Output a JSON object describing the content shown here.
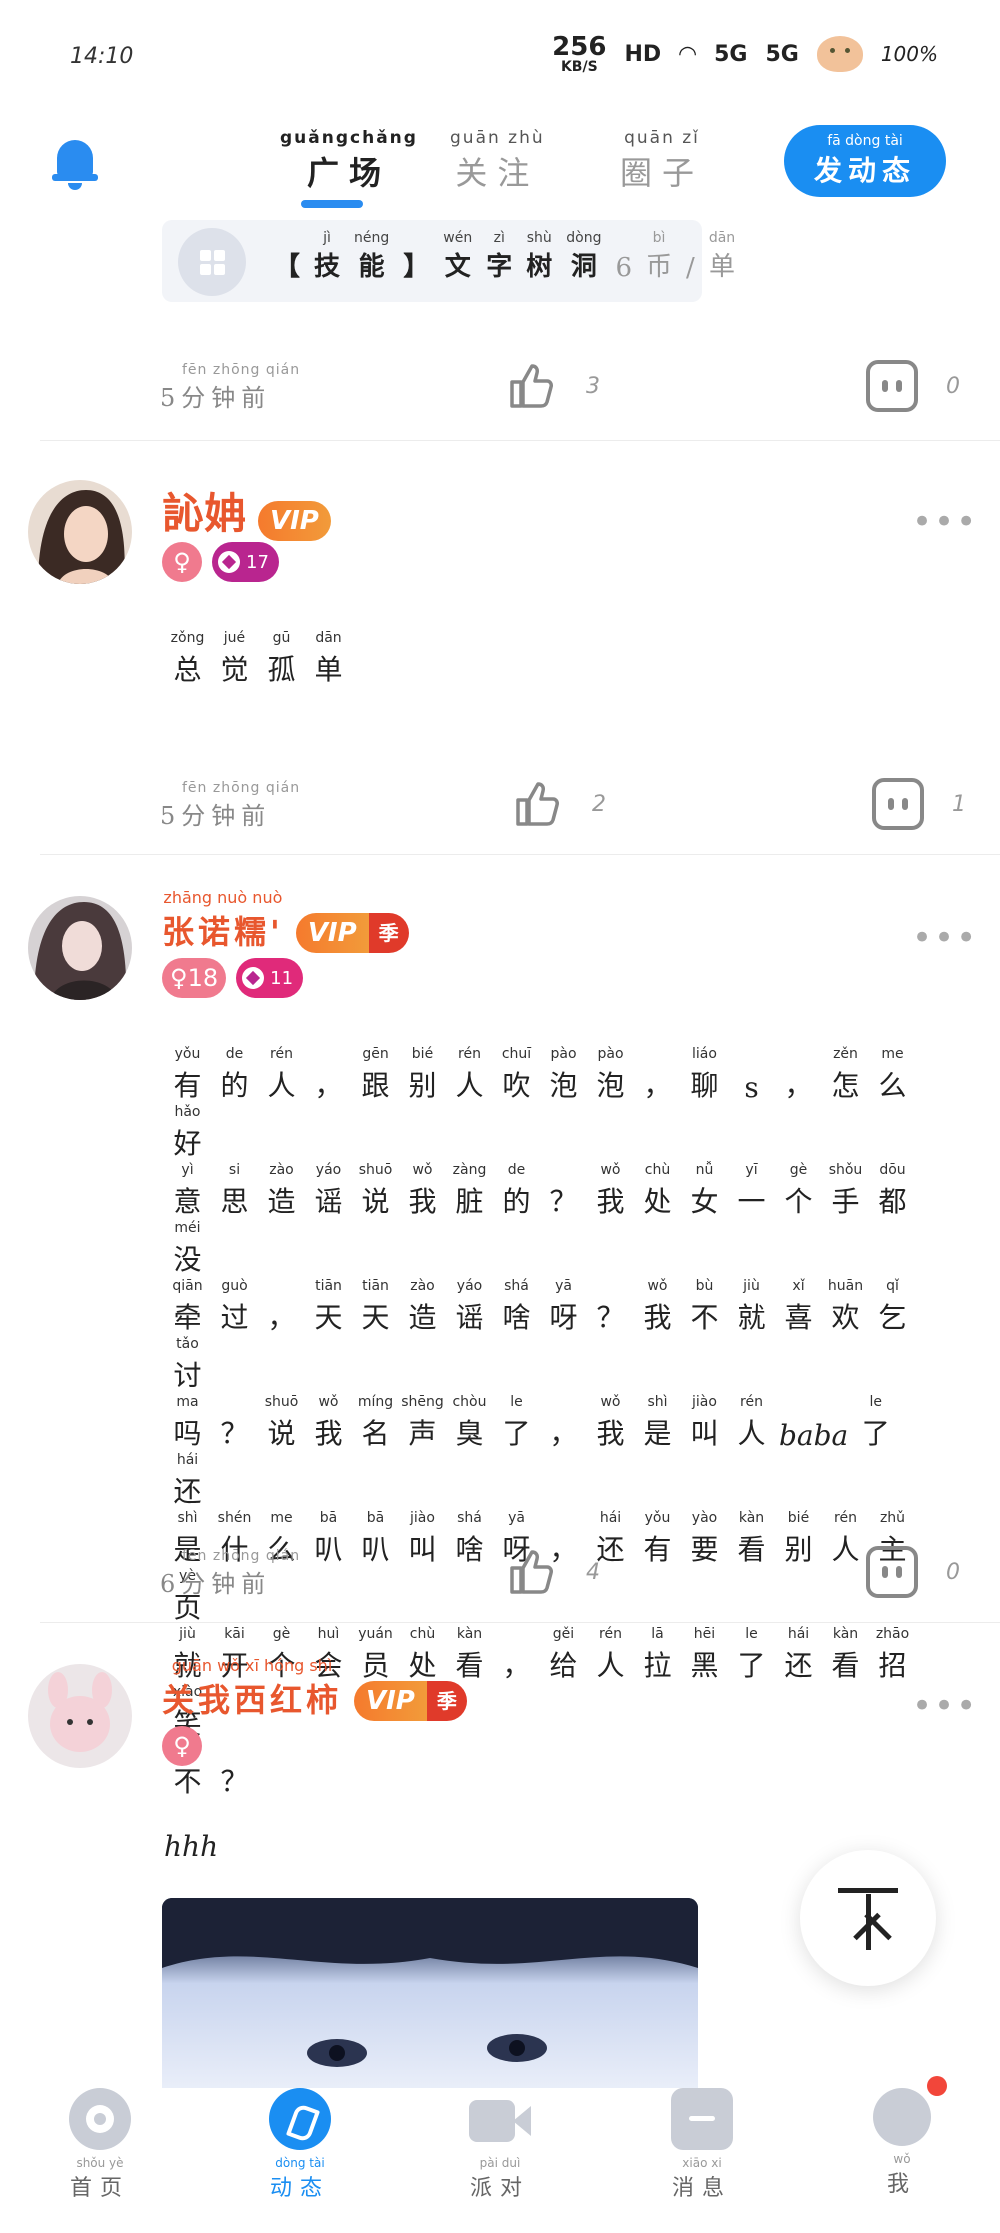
{
  "status_bar": {
    "time": "14:10",
    "net_speed_value": "256",
    "net_speed_unit": "KB/S",
    "hd_label": "HD",
    "signal1": "5G",
    "signal2": "5G",
    "battery": "100%"
  },
  "header": {
    "tabs": [
      {
        "py": "guǎngchǎng",
        "hz": "广场"
      },
      {
        "py": "guān zhù",
        "hz": "关注"
      },
      {
        "py": "quān zǐ",
        "hz": "圈子"
      }
    ],
    "post_button": {
      "py": "fā dòng tài",
      "hz": "发动态"
    }
  },
  "skill_card": {
    "bracket_open": "【",
    "bracket_close": "】",
    "items": [
      {
        "py": "jì",
        "hz": "技"
      },
      {
        "py": "néng",
        "hz": "能"
      }
    ],
    "text": [
      {
        "py": "wén",
        "hz": "文"
      },
      {
        "py": "zì",
        "hz": "字"
      },
      {
        "py": "shù",
        "hz": "树"
      },
      {
        "py": "dòng",
        "hz": "洞"
      }
    ],
    "price": [
      {
        "py": "",
        "hz": "6"
      },
      {
        "py": "bì",
        "hz": "币"
      },
      {
        "py": "",
        "hz": "/"
      },
      {
        "py": "dān",
        "hz": "单"
      }
    ]
  },
  "post0_meta": {
    "time_py": "fēn zhōng qián",
    "time_num": "5",
    "time_hz": "分钟前",
    "likes": "3",
    "comments": "0"
  },
  "posts": [
    {
      "name": "訫姌",
      "vip": "VIP",
      "gender": "♀",
      "level": "17",
      "text_lines": [
        [
          [
            "zǒng",
            "总"
          ],
          [
            "jué",
            "觉"
          ],
          [
            "gū",
            "孤"
          ],
          [
            "dān",
            "单"
          ]
        ]
      ],
      "meta": {
        "time_py": "fēn zhōng qián",
        "time_num": "5",
        "time_hz": "分钟前",
        "likes": "2",
        "comments": "1"
      }
    },
    {
      "name_py": "zhāng nuò nuò",
      "name": "张诺糯",
      "name_suffix": "'",
      "vip": "VIP",
      "vip_season": "季",
      "gender": "♀18",
      "level": "11",
      "text_lines": [
        [
          [
            "yǒu",
            "有"
          ],
          [
            "de",
            "的"
          ],
          [
            "rén",
            "人"
          ],
          [
            "",
            "，"
          ],
          [
            "gēn",
            "跟"
          ],
          [
            "bié",
            "别"
          ],
          [
            "rén",
            "人"
          ],
          [
            "chuī",
            "吹"
          ],
          [
            "pào",
            "泡"
          ],
          [
            "pào",
            "泡"
          ],
          [
            "",
            "，"
          ],
          [
            "liáo",
            "聊"
          ],
          [
            "",
            "s"
          ],
          [
            "",
            "，"
          ],
          [
            "zěn",
            "怎"
          ],
          [
            "me",
            "么"
          ],
          [
            "hǎo",
            "好"
          ]
        ],
        [
          [
            "yì",
            "意"
          ],
          [
            "si",
            "思"
          ],
          [
            "zào",
            "造"
          ],
          [
            "yáo",
            "谣"
          ],
          [
            "shuō",
            "说"
          ],
          [
            "wǒ",
            "我"
          ],
          [
            "zàng",
            "脏"
          ],
          [
            "de",
            "的"
          ],
          [
            "",
            "？"
          ],
          [
            "wǒ",
            "我"
          ],
          [
            "chù",
            "处"
          ],
          [
            "nǚ",
            "女"
          ],
          [
            "yī",
            "一"
          ],
          [
            "gè",
            "个"
          ],
          [
            "shǒu",
            "手"
          ],
          [
            "dōu",
            "都"
          ],
          [
            "méi",
            "没"
          ]
        ],
        [
          [
            "qiān",
            "牵"
          ],
          [
            "guò",
            "过"
          ],
          [
            "",
            "，"
          ],
          [
            "tiān",
            "天"
          ],
          [
            "tiān",
            "天"
          ],
          [
            "zào",
            "造"
          ],
          [
            "yáo",
            "谣"
          ],
          [
            "shá",
            "啥"
          ],
          [
            "yā",
            "呀"
          ],
          [
            "",
            "？"
          ],
          [
            "wǒ",
            "我"
          ],
          [
            "bù",
            "不"
          ],
          [
            "jiù",
            "就"
          ],
          [
            "xǐ",
            "喜"
          ],
          [
            "huān",
            "欢"
          ],
          [
            "qǐ",
            "乞"
          ],
          [
            "tǎo",
            "讨"
          ]
        ],
        [
          [
            "ma",
            "吗"
          ],
          [
            "",
            "？"
          ],
          [
            "shuō",
            "说"
          ],
          [
            "wǒ",
            "我"
          ],
          [
            "míng",
            "名"
          ],
          [
            "shēng",
            "声"
          ],
          [
            "chòu",
            "臭"
          ],
          [
            "le",
            "了"
          ],
          [
            "",
            "，"
          ],
          [
            "wǒ",
            "我"
          ],
          [
            "shì",
            "是"
          ],
          [
            "jiào",
            "叫"
          ],
          [
            "rén",
            "人"
          ],
          [
            "",
            "baba"
          ],
          [
            "le",
            "了"
          ],
          [
            "hái",
            "还"
          ]
        ],
        [
          [
            "shì",
            "是"
          ],
          [
            "shén",
            "什"
          ],
          [
            "me",
            "么"
          ],
          [
            "bā",
            "叭"
          ],
          [
            "bā",
            "叭"
          ],
          [
            "jiào",
            "叫"
          ],
          [
            "shá",
            "啥"
          ],
          [
            "yā",
            "呀"
          ],
          [
            "",
            "，"
          ],
          [
            "hái",
            "还"
          ],
          [
            "yǒu",
            "有"
          ],
          [
            "yào",
            "要"
          ],
          [
            "kàn",
            "看"
          ],
          [
            "bié",
            "别"
          ],
          [
            "rén",
            "人"
          ],
          [
            "zhǔ",
            "主"
          ],
          [
            "yè",
            "页"
          ]
        ],
        [
          [
            "jiù",
            "就"
          ],
          [
            "kāi",
            "开"
          ],
          [
            "gè",
            "个"
          ],
          [
            "huì",
            "会"
          ],
          [
            "yuán",
            "员"
          ],
          [
            "chù",
            "处"
          ],
          [
            "kàn",
            "看"
          ],
          [
            "",
            "，"
          ],
          [
            "gěi",
            "给"
          ],
          [
            "rén",
            "人"
          ],
          [
            "lā",
            "拉"
          ],
          [
            "hēi",
            "黑"
          ],
          [
            "le",
            "了"
          ],
          [
            "hái",
            "还"
          ],
          [
            "kàn",
            "看"
          ],
          [
            "zhāo",
            "招"
          ],
          [
            "xiào",
            "笑"
          ]
        ],
        [
          [
            "bù",
            "不"
          ],
          [
            "",
            "？"
          ]
        ]
      ],
      "meta": {
        "time_py": "fēn zhōng qián",
        "time_num": "6",
        "time_hz": "分钟前",
        "likes": "4",
        "comments": "0"
      }
    },
    {
      "name_py": "guān wǒ xī hóng shì",
      "name": "关我西红柿",
      "vip": "VIP",
      "vip_season": "季",
      "gender": "♀",
      "text": "hhh"
    }
  ],
  "bottom_nav": [
    {
      "py": "shǒu yè",
      "hz": "首页"
    },
    {
      "py": "dòng tài",
      "hz": "动态"
    },
    {
      "py": "pài duì",
      "hz": "派对"
    },
    {
      "py": "xiāo xi",
      "hz": "消息"
    },
    {
      "py": "wǒ",
      "hz": "我"
    }
  ],
  "colors": {
    "accent": "#1a8ef2",
    "name": "#e8572e",
    "vip": "#f57a2d"
  }
}
